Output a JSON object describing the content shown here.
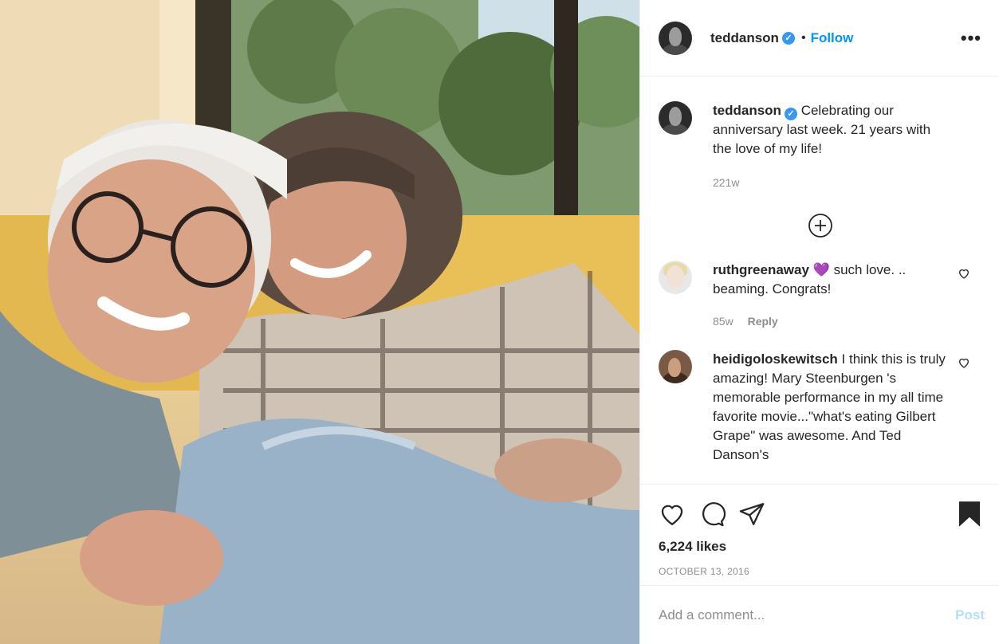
{
  "post": {
    "author": "teddanson",
    "follow_label": "Follow",
    "separator": "•",
    "more_label": "•••",
    "verified_mark": "✓",
    "photo_alt": "Photo"
  },
  "caption": {
    "user": "teddanson",
    "text": "Celebrating our anniversary last week. 21 years with the love of my life!",
    "age": "221w"
  },
  "comments": [
    {
      "user": "ruthgreenaway",
      "emoji": "💜",
      "text": " such love. .. beaming. Congrats!",
      "age": "85w",
      "reply_label": "Reply"
    },
    {
      "user": "heidigoloskewitsch",
      "text": " I think this is truly amazing! Mary Steenburgen 's memorable performance in my all time favorite movie...\"what's eating Gilbert Grape\" was awesome. And Ted Danson's"
    }
  ],
  "stats": {
    "likes": "6,224 likes",
    "date": "OCTOBER 13, 2016"
  },
  "composer": {
    "placeholder": "Add a comment...",
    "post_label": "Post"
  },
  "icons": {
    "like": "heart-icon",
    "comment": "comment-bubble-icon",
    "share": "paper-plane-icon",
    "save": "bookmark-filled-icon",
    "load_more": "plus-circle-icon",
    "comment_like": "small-heart-icon"
  },
  "colors": {
    "link_blue": "#0095f6",
    "post_disabled": "#b2dffc",
    "secondary_text": "#8e8e8e",
    "verified": "#3897f0"
  }
}
